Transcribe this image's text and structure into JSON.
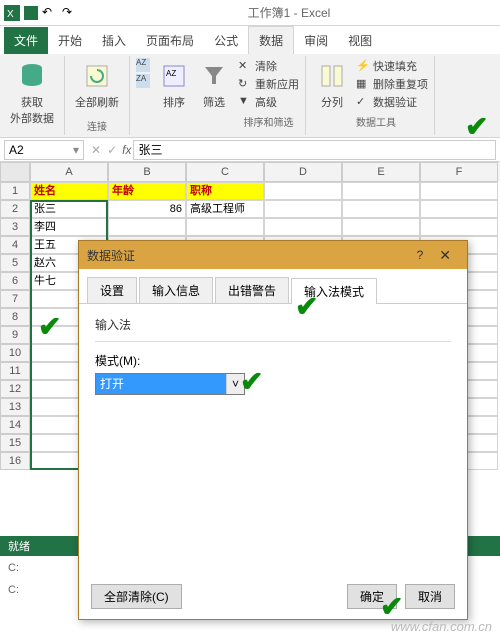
{
  "title": "工作簿1 - Excel",
  "tabs": {
    "file": "文件",
    "home": "开始",
    "insert": "插入",
    "pagelayout": "页面布局",
    "formulas": "公式",
    "data": "数据",
    "review": "审阅",
    "view": "视图"
  },
  "ribbon": {
    "get_external": "获取\n外部数据",
    "refresh_all": "全部刷新",
    "connections_label": "连接",
    "sort_az": "A→Z",
    "sort_za": "Z→A",
    "sort": "排序",
    "filter": "筛选",
    "clear": "清除",
    "reapply": "重新应用",
    "advanced": "高级",
    "sort_filter_label": "排序和筛选",
    "text_to_columns": "分列",
    "flash_fill": "快速填充",
    "remove_duplicates": "删除重复项",
    "data_validation": "数据验证",
    "data_tools_label": "数据工具"
  },
  "namebox": "A2",
  "formula_value": "张三",
  "columns": [
    "A",
    "B",
    "C",
    "D",
    "E",
    "F"
  ],
  "rows": {
    "r1": {
      "a": "姓名",
      "b": "年龄",
      "c": "职称"
    },
    "r2": {
      "a": "张三",
      "b": "86",
      "c": "高级工程师"
    },
    "r3": {
      "a": "李四"
    },
    "r4": {
      "a": "王五"
    },
    "r5": {
      "a": "赵六"
    },
    "r6": {
      "a": "牛七"
    }
  },
  "dialog": {
    "title": "数据验证",
    "tabs": {
      "settings": "设置",
      "input_msg": "输入信息",
      "error_alert": "出错警告",
      "ime": "输入法模式"
    },
    "section": "输入法",
    "mode_label": "模式(M):",
    "mode_value": "打开",
    "clear_all": "全部清除(C)",
    "ok": "确定",
    "cancel": "取消"
  },
  "statusbar": "就绪",
  "footer_c": "C:",
  "footer_c2": "C:",
  "watermark": "www.cfan.com.cn"
}
